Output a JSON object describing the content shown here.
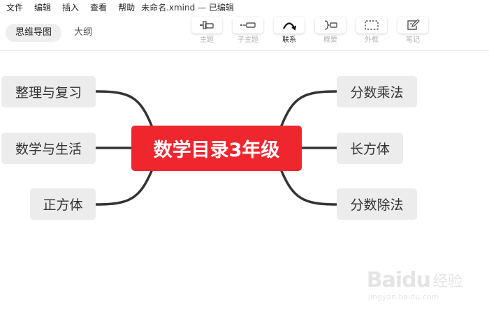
{
  "menu": {
    "items": [
      "文件",
      "编辑",
      "插入",
      "查看",
      "帮助"
    ],
    "doc_title": "未命名.xmind — 已编辑"
  },
  "view_tabs": [
    {
      "label": "思维导图",
      "active": true
    },
    {
      "label": "大纲",
      "active": false
    }
  ],
  "tools": [
    {
      "label": "主题",
      "icon": "topic-icon",
      "active": false
    },
    {
      "label": "子主题",
      "icon": "subtopic-icon",
      "active": false
    },
    {
      "label": "联系",
      "icon": "relationship-icon",
      "active": true
    },
    {
      "label": "概要",
      "icon": "summary-icon",
      "active": false
    },
    {
      "label": "外框",
      "icon": "boundary-icon",
      "active": false
    },
    {
      "label": "笔记",
      "icon": "note-icon",
      "active": false
    }
  ],
  "mindmap": {
    "central_topic": "数学目录3年级",
    "left_topics": [
      "整理与复习",
      "数学与生活",
      "正方体"
    ],
    "right_topics": [
      "分数乘法",
      "长方体",
      "分数除法"
    ],
    "central_color": "#f0262f",
    "connector_color": "#333333"
  },
  "watermark": {
    "brand": "Baidu",
    "sub": "经验",
    "url": "jingyan.baidu.com"
  }
}
